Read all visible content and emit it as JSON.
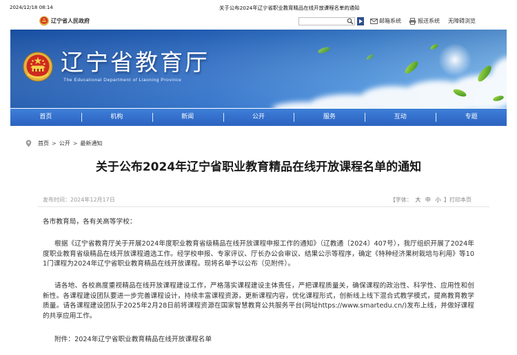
{
  "print_header": {
    "timestamp": "2024/12/18 08:14",
    "title": "关于公布2024年辽宁省职业教育精品在线开放课程名单的通知"
  },
  "topbar": {
    "gov_name": "辽宁省人民政府",
    "mail_label": "邮箱系统",
    "report_label": "报送系统",
    "accessibility_label": "无障碍浏览"
  },
  "banner": {
    "title": "辽宁省教育厅",
    "subtitle": "The Educational Department of Liaoning Province"
  },
  "nav": {
    "items": [
      "首页",
      "机构",
      "新闻",
      "公开",
      "服务",
      "互动",
      "专题"
    ]
  },
  "breadcrumb": {
    "items": [
      "首页",
      "公开",
      "最新通知"
    ],
    "separator": ">"
  },
  "article": {
    "title": "关于公布2024年辽宁省职业教育精品在线开放课程名单的通知",
    "publish_label": "发布时间：",
    "publish_date": "2024年12月17日",
    "font_size_label": "【字体：",
    "font_size_options": [
      "大",
      "中",
      "小"
    ],
    "font_size_end": "】",
    "print_label": "打印本页",
    "salutation": "各市教育局，各有关高等学校：",
    "paragraphs": [
      "根据《辽宁省教育厅关于开展2024年度职业教育省级精品在线开放课程申报工作的通知》（辽教通〔2024〕407号），我厅组织开展了2024年度职业教育省级精品在线开放课程遴选工作。经学校申报、专家评议、厅长办公会审议、结果公示等程序，确定《特种经济果树栽培与利用》等101门课程为2024年辽宁省职业教育精品在线开放课程。现将名单予以公布（见附件）。",
      "请各地、各校高度重视精品在线开放课程建设工作，严格落实课程建设主体责任，严把课程质量关，确保课程的政治性、科学性、应用性和创新性。各课程建设团队要进一步完善课程设计，持续丰富课程资源，更新课程内容，优化课程形式，创新线上线下混合式教学模式，提高教育教学质量。请各课程建设团队于2025年2月28日前将课程资源在国家智慧教育公共服务平台(网址https://www.smartedu.cn/)发布上线，并做好课程的共享应用工作。"
    ],
    "attachment_label": "附件：",
    "attachment_name": "2024年辽宁省职业教育精品在线开放课程名单"
  },
  "icons": {
    "emblem": "national-emblem-icon",
    "search": "search-icon",
    "search_go": "arrow-right-icon",
    "mail": "mail-icon",
    "report": "printer-icon",
    "location": "location-pin-icon",
    "leaves": "leaf-icon"
  },
  "colors": {
    "nav_background": "#3470cc",
    "banner_sky": "#2f73cc",
    "title_text": "#1a1a1a",
    "body_text": "#333333",
    "meta_text": "#999999"
  }
}
